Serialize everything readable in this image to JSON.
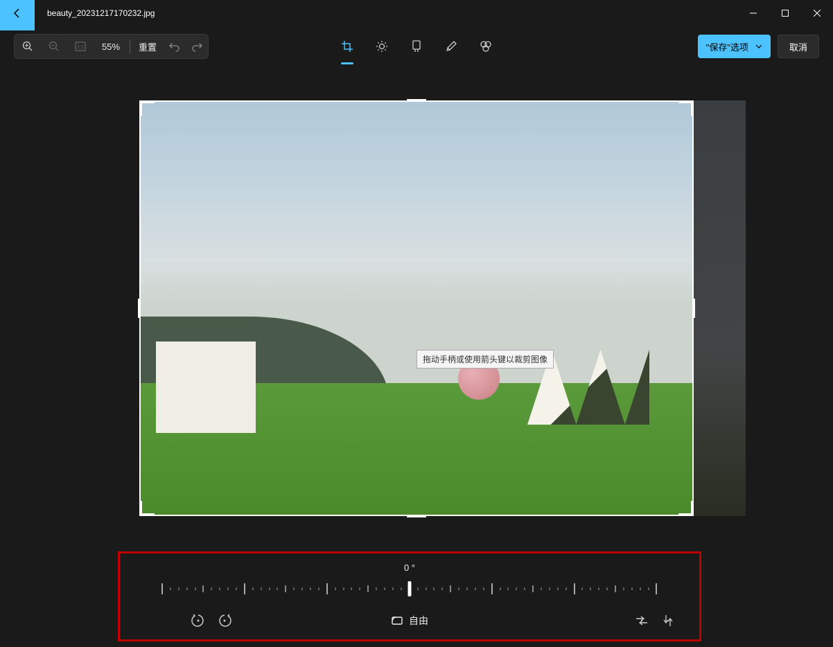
{
  "titlebar": {
    "filename": "beauty_20231217170232.jpg"
  },
  "toolbar": {
    "zoom_value": "55%",
    "reset_label": "重置"
  },
  "actions": {
    "save_label": "\"保存\"选项",
    "cancel_label": "取消"
  },
  "tooltip": {
    "crop_hint": "拖动手柄或使用箭头键以裁剪图像"
  },
  "rotation": {
    "degree_label": "0 °",
    "aspect_label": "自由"
  },
  "tools": {
    "crop": "crop",
    "adjust": "adjust",
    "filter": "filter",
    "markup": "markup",
    "retouch": "retouch"
  }
}
